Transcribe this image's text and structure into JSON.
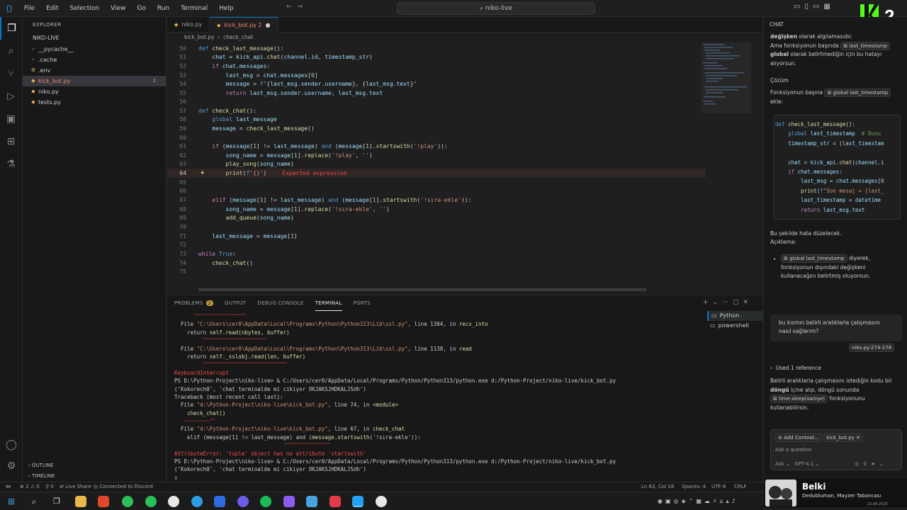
{
  "titlebar": {
    "menu": [
      "File",
      "Edit",
      "Selection",
      "View",
      "Go",
      "Run",
      "Terminal",
      "Help"
    ],
    "search": "niko-live",
    "brand_badge": "2"
  },
  "explorer": {
    "title": "EXPLORER",
    "root": "NIKO-LIVE",
    "items": [
      {
        "label": "__pycache__",
        "kind": "folder"
      },
      {
        "label": ".cache",
        "kind": "file"
      },
      {
        "label": ".env",
        "kind": "file"
      },
      {
        "label": "kick_bot.py",
        "kind": "py",
        "badge": "2"
      },
      {
        "label": "niko.py",
        "kind": "py"
      },
      {
        "label": "tests.py",
        "kind": "py"
      }
    ],
    "outline": "OUTLINE",
    "timeline": "TIMELINE"
  },
  "tabs": [
    {
      "label": "niko.py"
    },
    {
      "label": "kick_bot.py 2"
    }
  ],
  "breadcrumb": {
    "file": "kick_bot.py",
    "symbol": "check_chat"
  },
  "editor": {
    "error_message": "Expected expression"
  },
  "panel": {
    "tabs": [
      "PROBLEMS",
      "OUTPUT",
      "DEBUG CONSOLE",
      "TERMINAL",
      "PORTS"
    ],
    "problems_count": "2",
    "terminals": [
      "Python",
      "powershell"
    ]
  },
  "chat": {
    "title": "CHAT",
    "p1_part1": "değişken",
    "p1_part2": " olarak algılamasıdır.",
    "p1_line2": "Ama fonksiyonun başında",
    "p1_chip": "last_timestamp",
    "p1_line3_bold": "global",
    "p1_line3": " olarak belirtmediğin için bu hatayı alıyorsun.",
    "solution": "Çözüm",
    "sol_text": "Fonksiyonun başına",
    "sol_chip": "global last_timestamp",
    "sol_text2": "ekle:",
    "after_code": "Bu şekilde hata düzelecek.",
    "explain": "Açıklama:",
    "bullet_chip": "global last_timestamp",
    "bullet_text": " diyerek, fonksiyonun dışındaki değişkeni kullanacağını belirtmiş oluyorsun.",
    "user_q": "bu kısmın belirli aralıklarla çalışmasını nasıl sağlarım?",
    "ref_chip": "niko.py:274-278",
    "used_ref": "Used 1 reference",
    "ans1": "Belirli aralıklarla çalışmasını istediğin kodu bir ",
    "ans1_bold": "döngü",
    "ans1b": " içine alıp, döngü sonunda",
    "ans_chip": "time.sleep(saniye)",
    "ans2": " fonksiyonunu kullanabilirsin.",
    "input_add": "Add Context...",
    "input_file": "kick_bot.py",
    "input_placeholder": "Ask a question",
    "mode": "Ask",
    "model": "GPT-4.1"
  },
  "statusbar": {
    "errors": "2",
    "warnings": "0",
    "ports": "0",
    "live_share": "Live Share",
    "discord": "Connected to Discord",
    "cursor": "Ln 63, Col 18",
    "spaces": "Spaces: 4",
    "encoding": "UTF-8",
    "eol": "CRLF"
  },
  "overlay": {
    "title": "Belki",
    "subtitle": "Dedubluman, Mayzer Tabancası",
    "date": "22.06.2025"
  }
}
